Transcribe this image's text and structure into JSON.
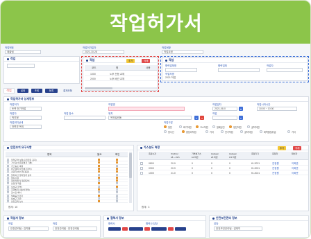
{
  "banner": {
    "title": "작업허가서"
  },
  "top_left": {
    "label_no": "작업번호",
    "value_no": "제출팀",
    "label_date": "작업허가일자",
    "value_date": "2021-10-28",
    "label_status": "작업현황",
    "value_status": "작업요청"
  },
  "work_panel": {
    "title": "작업",
    "items": [
      "작업",
      "작업"
    ],
    "header_label": "작업",
    "head_btns": [
      "추가",
      "삭제"
    ],
    "columns": [
      "코드",
      "명",
      "사용"
    ],
    "rows": [
      {
        "code": "1000",
        "name": "노후 전등 교체"
      },
      {
        "code": "2000",
        "name": "노후 배관 교체"
      }
    ]
  },
  "worker_panel": {
    "title": "작업",
    "labels": [
      "협력업체명",
      "협력업체",
      "작업자"
    ],
    "sub_labels": [
      "작업자명",
      "작업자"
    ],
    "sub_value": "2021-10-23",
    "extra": "2021 작업"
  },
  "nav": {
    "tabs": [
      "작업",
      "설정",
      "조회",
      "등록",
      "결재요청"
    ],
    "actions": [
      "저장",
      "삭제",
      "출력"
    ]
  },
  "detail_panel": {
    "title": "작업허가서 상세정보",
    "fields": [
      {
        "label": "작업허가",
        "value": "토목 전기작업"
      },
      {
        "label": "작업명",
        "value": ""
      },
      {
        "label": "작업일자",
        "value": "2021-08-0"
      },
      {
        "label": "작업시작시간",
        "value": "10:00 ~ 10:30"
      },
      {
        "label": "작업자",
        "value": "박진형"
      },
      {
        "label": "작업 장소",
        "value": ""
      },
      {
        "label": "위치",
        "value": "옥외설비동"
      },
      {
        "label": "작업",
        "value": ""
      },
      {
        "label": "작업위치상세",
        "value": "전면부 옥외"
      }
    ],
    "sub_label": "작업구분",
    "options": [
      "일반",
      "화기작업",
      "고소작업",
      "밀폐공간",
      "정전작업",
      "굴착작업",
      "방사선",
      "중장비작업",
      "기타",
      "전기작업",
      "굴착작업",
      "화학물질취급",
      "기타"
    ]
  },
  "safety_panel": {
    "title": "안전조치 요구사항",
    "columns": [
      "항목",
      "필요",
      "확인"
    ],
    "rows": [
      "작업구역 설정(출입금지 표지)",
      "가스검사(측정결과 기록)",
      "가스농도 측정",
      "환기설비(국소배기장치)",
      "소화기(비치 및 점검)",
      "불티비산 방지덮개 설치",
      "접지시설",
      "정전작업 및 잠금장치",
      "안전대 착용",
      "보호구(헬멧)",
      "추락방지시설(안전망)",
      "감시인 배치",
      "밀폐공간 환기",
      "보호구 지급",
      "안전교육 실시"
    ],
    "footer": "합계 : 15"
  },
  "measure_panel": {
    "title": "가스농도 측정",
    "head_btns": [
      "추가",
      "삭제"
    ],
    "columns": [
      "측정시간",
      "Oxidizer",
      "가연성가스",
      "Halogen",
      "Halogen",
      "측정기기",
      "측정자",
      "확인자"
    ],
    "sub_columns": [
      "",
      "18 ~ 23.5",
      "10 미만",
      "25 미만",
      "0.5 미만",
      "",
      "",
      ""
    ],
    "rows": [
      [
        "0800",
        "20.9",
        "0",
        "0",
        "0",
        "KI-2021",
        "전정원",
        "이희준"
      ],
      [
        "0900",
        "20.9",
        "0",
        "0",
        "0",
        "KI-2021",
        "전정원",
        "이희준"
      ],
      [
        "1000",
        "21.0",
        "0",
        "0",
        "0",
        "KI-2021",
        "전정원",
        "이희준"
      ]
    ],
    "footer": "합계 : 3"
  },
  "bottom": {
    "b1_title": "작업자 정보",
    "b1_labels": [
      "작업",
      "작업"
    ],
    "b1_value": "안전관리팀 : 김지용",
    "b1_value2": "안전관리팀 : 안전관리팀",
    "b2_title": "협력사 정보",
    "b2_labels": [
      "협력사",
      "협력사 담당"
    ],
    "b3_title": "안전보건관리 정보",
    "b3_labels": [
      "담당"
    ],
    "b3_value": "안전보건관리팀 : 김재직"
  },
  "colors": {
    "banner": "#8cc54a",
    "accent": "#27418c",
    "danger": "#e04848",
    "warning": "#f2a232"
  }
}
